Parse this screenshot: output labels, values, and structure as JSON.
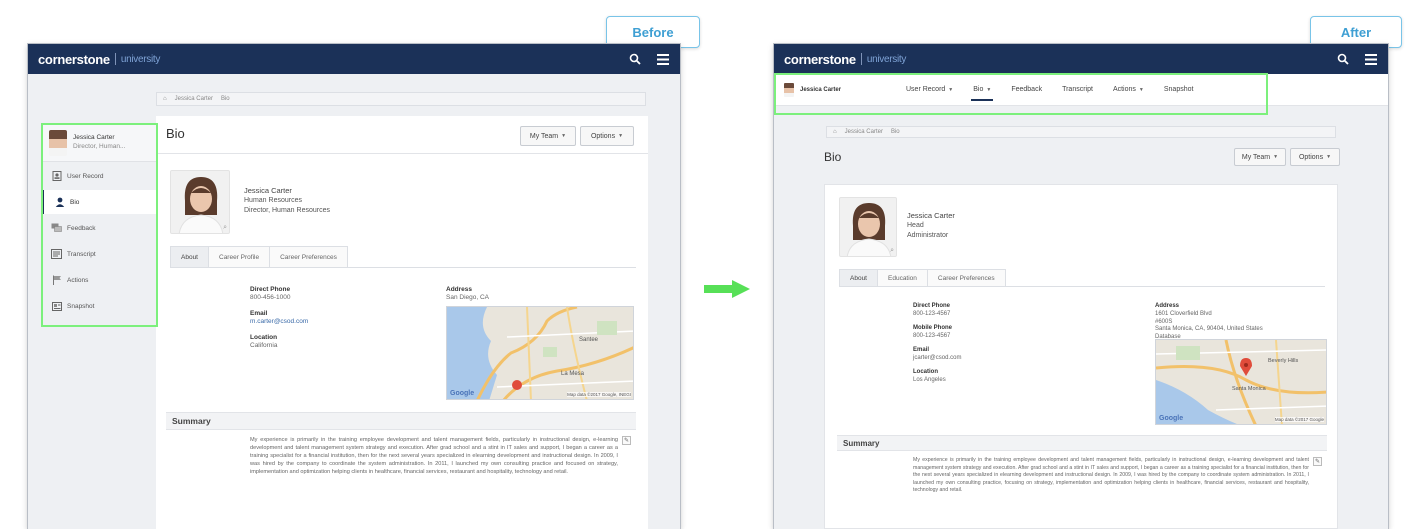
{
  "labels": {
    "before": "Before",
    "after": "After"
  },
  "brand": {
    "name": "cornerstone",
    "sub": "university"
  },
  "icons": {
    "search": "search-icon",
    "menu": "hamburger-menu-icon",
    "home": "home-icon",
    "caret": "caret-down-icon",
    "edit": "edit-icon"
  },
  "colors": {
    "topbar": "#1b3158",
    "highlight": "#7cf07c",
    "label_border": "#79c4e8",
    "arrow": "#57e057"
  },
  "before": {
    "breadcrumb": [
      "Jessica Carter",
      "Bio"
    ],
    "user": {
      "name": "Jessica Carter",
      "title": "Director, Human..."
    },
    "sidebar": [
      {
        "label": "User Record",
        "icon": "user-record-icon"
      },
      {
        "label": "Bio",
        "icon": "person-icon"
      },
      {
        "label": "Feedback",
        "icon": "feedback-icon"
      },
      {
        "label": "Transcript",
        "icon": "transcript-icon"
      },
      {
        "label": "Actions",
        "icon": "actions-flag-icon"
      },
      {
        "label": "Snapshot",
        "icon": "snapshot-icon"
      }
    ],
    "page_title": "Bio",
    "buttons": {
      "team": "My Team",
      "options": "Options"
    },
    "profile": {
      "name": "Jessica Carter",
      "line1": "Human Resources",
      "line2": "Director, Human Resources"
    },
    "tabs": [
      "About",
      "Career Profile",
      "Career Preferences"
    ],
    "fields": {
      "phone_label": "Direct Phone",
      "phone": "800-456-1000",
      "email_label": "Email",
      "email": "m.carter@csod.com",
      "location_label": "Location",
      "location": "California",
      "address_label": "Address",
      "address": "San Diego, CA"
    },
    "map": {
      "credit": "Map data ©2017 Google, INEGI",
      "logo": "Google",
      "places": [
        "Santee",
        "La Mesa"
      ]
    },
    "summary_title": "Summary",
    "summary": "My experience is primarily in the training employee development and talent management fields, particularly in instructional design, e-learning development and talent management system strategy and execution. After grad school and a stint in IT sales and support, I began a career as a training specialist for a financial institution, then for the next several years specialized in elearning development and instructional design. In 2009, I was hired by the company to coordinate the system administration. In 2011, I launched my own consulting practice and focused on strategy, implementation and optimization helping clients in healthcare, financial services, restaurant and hospitality, technology and retail."
  },
  "after": {
    "user_name": "Jessica Carter",
    "nav": [
      {
        "label": "User Record",
        "caret": true
      },
      {
        "label": "Bio",
        "caret": true
      },
      {
        "label": "Feedback",
        "caret": false
      },
      {
        "label": "Transcript",
        "caret": false
      },
      {
        "label": "Actions",
        "caret": true
      },
      {
        "label": "Snapshot",
        "caret": false
      }
    ],
    "breadcrumb": [
      "Jessica Carter",
      "Bio"
    ],
    "page_title": "Bio",
    "buttons": {
      "team": "My Team",
      "options": "Options"
    },
    "profile": {
      "name": "Jessica Carter",
      "line1": "Head",
      "line2": "Administrator"
    },
    "tabs": [
      "About",
      "Education",
      "Career Preferences"
    ],
    "fields": {
      "phone_label": "Direct Phone",
      "phone": "800-123-4567",
      "mobile_label": "Mobile Phone",
      "mobile": "800-123-4567",
      "email_label": "Email",
      "email": "jcarter@csod.com",
      "location_label": "Location",
      "location": "Los Angeles",
      "address_label": "Address",
      "address1": "1601 Cloverfield Blvd",
      "address2": "#600S",
      "address3": "Santa Monica, CA, 90404, United States",
      "address4": "Database"
    },
    "map": {
      "credit": "Map data ©2017 Google",
      "logo": "Google",
      "places": [
        "Beverly Hills",
        "Santa Monica"
      ]
    },
    "summary_title": "Summary",
    "summary": "My experience is primarily in the training employee development and talent management fields, particularly in instructional design, e-learning development and talent management system strategy and execution. After grad school and a stint in IT sales and support, I began a career as a training specialist for a financial institution, then for the next several years specialized in elearning development and instructional design. In 2009, I was hired by the company to coordinate system administration. In 2011, I launched my own consulting practice, focusing on strategy, implementation and optimization helping clients in healthcare, financial services, restaurant and hospitality, technology and retail."
  }
}
